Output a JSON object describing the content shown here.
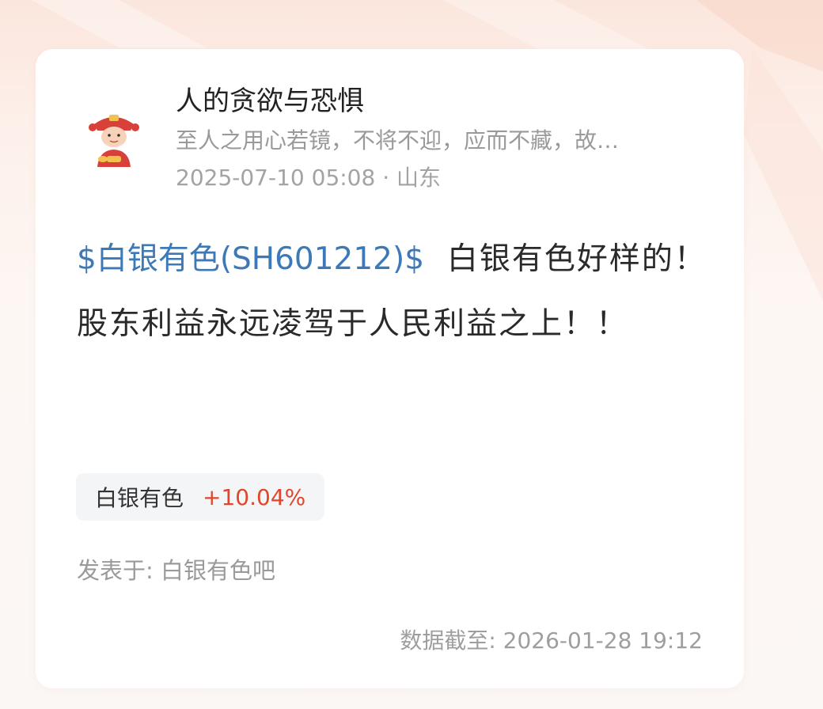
{
  "author": {
    "name": "人的贪欲与恐惧",
    "bio": "至人之用心若镜，不将不迎，应而不藏，故…",
    "timestamp": "2025-07-10 05:08",
    "separator": " · ",
    "location": "山东",
    "avatar_icon": "fortune-god-avatar-icon"
  },
  "post": {
    "stock_link": "$白银有色(SH601212)$",
    "text": "白银有色好样的！股东利益永远凌驾于人民利益之上！！"
  },
  "stock_tag": {
    "name": "白银有色",
    "change": "+10.04%",
    "change_color": "#e0462b"
  },
  "posted_in": "发表于: 白银有色吧",
  "data_as_of": "数据截至: 2026-01-28 19:12",
  "colors": {
    "link": "#3d79b6",
    "accent_bg": "#fbe6dd"
  }
}
